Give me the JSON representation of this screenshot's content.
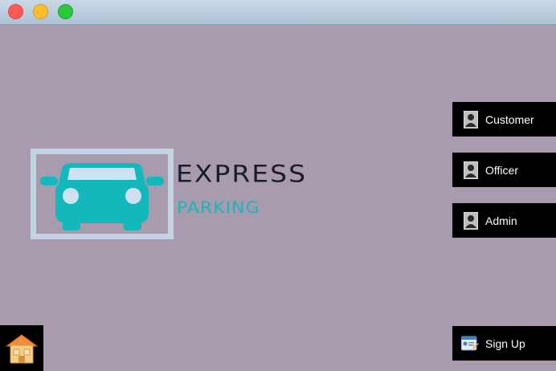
{
  "window": {
    "controls": [
      "close",
      "minimize",
      "zoom"
    ]
  },
  "logo": {
    "line1": "EXPRESS",
    "line2": "PARKING",
    "car_icon": "car-icon",
    "colors": {
      "car": "#12b8bb",
      "frame": "#c2d3e3",
      "line1": "#1b1d2d",
      "line2": "#1bb6bb"
    }
  },
  "roles": {
    "customer": {
      "label": "Customer",
      "icon": "person-icon"
    },
    "officer": {
      "label": "Officer",
      "icon": "person-icon"
    },
    "admin": {
      "label": "Admin",
      "icon": "person-icon"
    }
  },
  "signup": {
    "label": "Sign Up",
    "icon": "id-card-icon"
  },
  "home": {
    "icon": "home-icon"
  },
  "colors": {
    "background": "#a89bad",
    "button": "#000000",
    "button_text": "#ffffff"
  }
}
